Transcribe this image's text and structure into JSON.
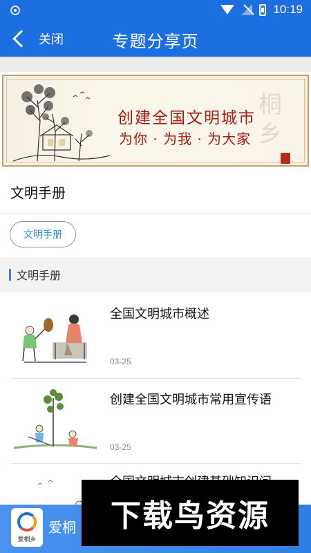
{
  "status_bar": {
    "time": "10:19"
  },
  "topbar": {
    "back_label": "关闭",
    "title": "专题分享页"
  },
  "banner": {
    "line1": "创建全国文明城市",
    "line2": "为你 · 为我 · 为大家",
    "watermark": "桐乡"
  },
  "section": {
    "title": "文明手册"
  },
  "tag": {
    "label": "文明手册"
  },
  "subhead": {
    "label": "文明手册"
  },
  "articles": [
    {
      "title": "全国文明城市概述",
      "date": "03-25"
    },
    {
      "title": "创建全国文明城市常用宣传语",
      "date": "03-25"
    },
    {
      "title": "全国文明城市创建基础知识问"
    }
  ],
  "bottom_bar": {
    "logo_text": "爱桐乡",
    "app_name": "爱桐"
  },
  "overlay": {
    "text": "下载鸟资源"
  },
  "colors": {
    "primary": "#1c6fe0",
    "accent": "#2e8fd4",
    "banner_text": "#a61b12"
  }
}
